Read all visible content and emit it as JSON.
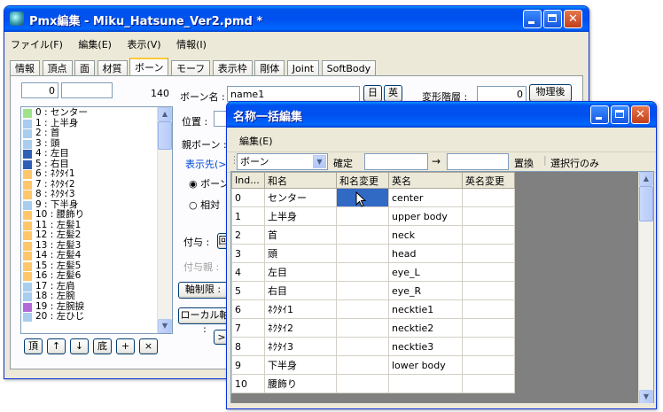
{
  "main": {
    "title": "Pmx編集 - Miku_Hatsune_Ver2.pmd *",
    "menu": [
      "ファイル(F)",
      "編集(E)",
      "表示(V)",
      "情報(I)"
    ],
    "tabs": [
      "情報",
      "頂点",
      "面",
      "材質",
      "ボーン",
      "モーフ",
      "表示枠",
      "剛体",
      "Joint",
      "SoftBody"
    ],
    "active_tab": "ボーン",
    "bone_panel": {
      "index_value": "0",
      "count": "140",
      "bones": [
        {
          "label": "0 : センター",
          "color": "#9ee38a"
        },
        {
          "label": "1 : 上半身",
          "color": "#a8cdee"
        },
        {
          "label": "2 : 首",
          "color": "#a8cdee"
        },
        {
          "label": "3 : 頭",
          "color": "#a8cdee"
        },
        {
          "label": "4 : 左目",
          "color": "#2f5fb4"
        },
        {
          "label": "5 : 右目",
          "color": "#2f5fb4"
        },
        {
          "label": "6 : ﾈｸﾀｲ1",
          "color": "#ffc66b"
        },
        {
          "label": "7 : ﾈｸﾀｲ2",
          "color": "#ffc66b"
        },
        {
          "label": "8 : ﾈｸﾀｲ3",
          "color": "#ffc66b"
        },
        {
          "label": "9 : 下半身",
          "color": "#a8cdee"
        },
        {
          "label": "10 : 腰飾り",
          "color": "#ffc66b"
        },
        {
          "label": "11 : 左髪1",
          "color": "#ffc66b"
        },
        {
          "label": "12 : 左髪2",
          "color": "#ffc66b"
        },
        {
          "label": "13 : 左髪3",
          "color": "#ffc66b"
        },
        {
          "label": "14 : 左髪4",
          "color": "#ffc66b"
        },
        {
          "label": "15 : 左髪5",
          "color": "#ffc66b"
        },
        {
          "label": "16 : 左髪6",
          "color": "#ffc66b"
        },
        {
          "label": "17 : 左肩",
          "color": "#a8cdee"
        },
        {
          "label": "18 : 左腕",
          "color": "#a8cdee"
        },
        {
          "label": "19 : 左腕捩",
          "color": "#b469d8"
        },
        {
          "label": "20 : 左ひじ",
          "color": "#a8cdee"
        }
      ],
      "list_buttons": [
        "頂",
        "↑",
        "↓",
        "底",
        "+",
        "×"
      ],
      "bone_name_label": "ボーン名 :",
      "bone_name_value": "name1",
      "jp_btn": "日",
      "en_btn": "英",
      "deform_label": "変形階層 :",
      "deform_value": "0",
      "physics_btn": "物理後",
      "position_label": "位置 :",
      "parent_label": "親ボーン :",
      "display_label": "表示先(>",
      "radio1": "ボーン",
      "radio2": "相対",
      "grant_label": "付与 :",
      "grant_btn": "回",
      "grant_parent_label": "付与親 :",
      "axis_btn": "軸制限 :",
      "local_axis_btn": "ローカル軸 :",
      "small_btn": ">"
    }
  },
  "popup": {
    "title": "名称一括編集",
    "menu": [
      "編集(E)"
    ],
    "target_select": "ボーン",
    "confirm_btn": "確定",
    "arrow": "→",
    "replace_btn": "置換",
    "selected_only_btn": "選択行のみ",
    "columns": [
      "Ind...",
      "和名",
      "和名変更",
      "英名",
      "英名変更"
    ],
    "rows": [
      [
        "0",
        "センター",
        "",
        "center",
        ""
      ],
      [
        "1",
        "上半身",
        "",
        "upper body",
        ""
      ],
      [
        "2",
        "首",
        "",
        "neck",
        ""
      ],
      [
        "3",
        "頭",
        "",
        "head",
        ""
      ],
      [
        "4",
        "左目",
        "",
        "eye_L",
        ""
      ],
      [
        "5",
        "右目",
        "",
        "eye_R",
        ""
      ],
      [
        "6",
        "ﾈｸﾀｲ1",
        "",
        "necktie1",
        ""
      ],
      [
        "7",
        "ﾈｸﾀｲ2",
        "",
        "necktie2",
        ""
      ],
      [
        "8",
        "ﾈｸﾀｲ3",
        "",
        "necktie3",
        ""
      ],
      [
        "9",
        "下半身",
        "",
        "lower body",
        ""
      ],
      [
        "10",
        "腰飾り",
        "",
        "",
        ""
      ]
    ],
    "selected_cell_color": "#316ac5"
  }
}
